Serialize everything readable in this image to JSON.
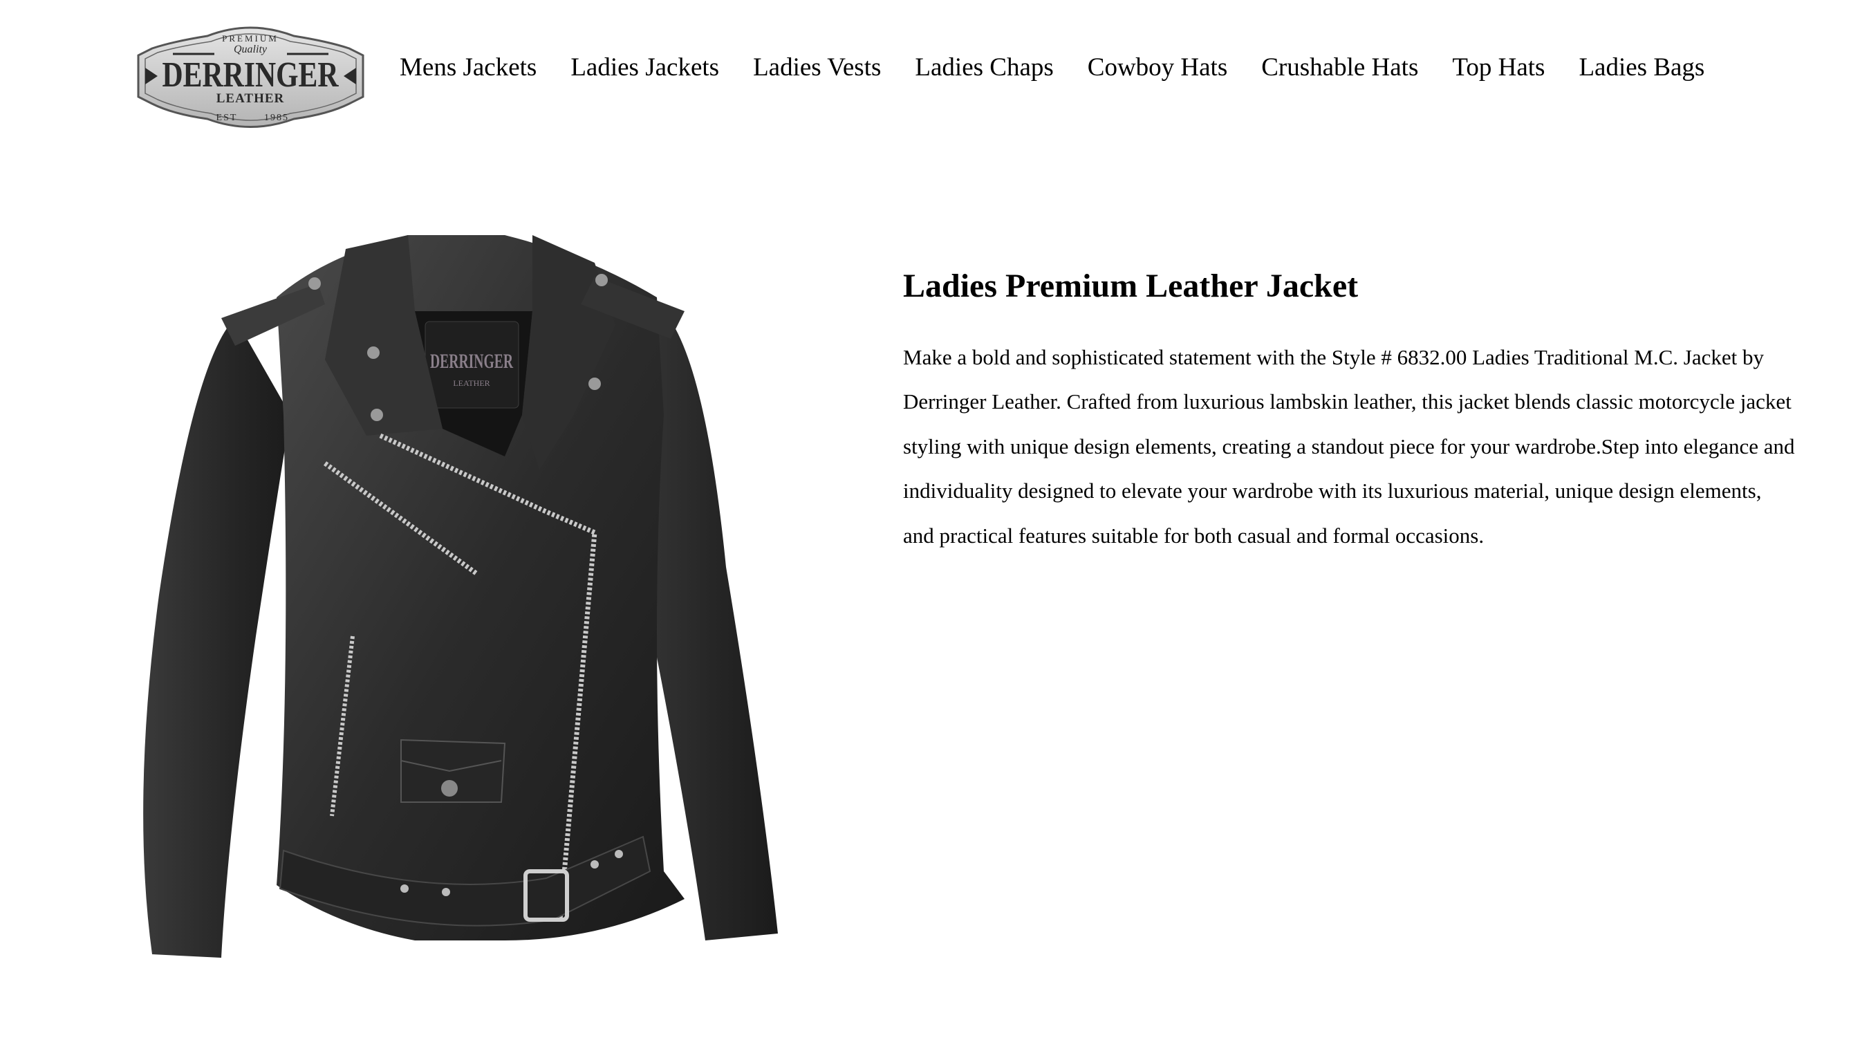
{
  "logo": {
    "top_text": "PREMIUM",
    "script_text": "Quality",
    "brand": "DERRINGER",
    "sub_text": "LEATHER",
    "est_text": "EST",
    "year_text": "1985"
  },
  "nav": {
    "items": [
      "Mens Jackets",
      "Ladies Jackets",
      "Ladies Vests",
      "Ladies Chaps",
      "Cowboy Hats",
      "Crushable Hats",
      "Top Hats",
      "Ladies Bags"
    ]
  },
  "product": {
    "title": "Ladies Premium Leather Jacket",
    "description": "Make a bold and sophisticated statement with the Style # 6832.00 Ladies Traditional M.C. Jacket by Derringer Leather. Crafted from luxurious lambskin leather, this jacket blends classic motorcycle jacket styling with unique design elements, creating a standout piece for your wardrobe.Step into elegance and individuality designed to elevate your wardrobe with its luxurious material, unique design elements, and practical features suitable for both casual and formal occasions.",
    "inner_label": "DERRINGER",
    "inner_sub": "LEATHER"
  },
  "colors": {
    "logo_fill": "#c8c8c8",
    "logo_ink": "#2a2a2a",
    "leather": "#2b2b2b",
    "zipper": "#c9c9c9"
  }
}
